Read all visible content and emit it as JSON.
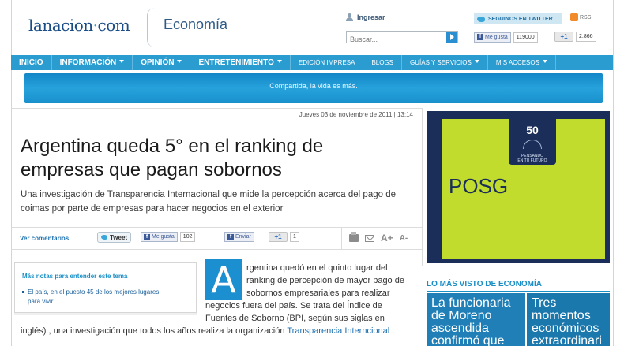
{
  "header": {
    "logo_main": "lanacion",
    "logo_dot": "·",
    "logo_tld": "com",
    "section": "Economía",
    "login_label": "Ingresar",
    "search_placeholder": "Buscar...",
    "twitter_follow": "SEGUINOS EN TWITTER",
    "rss": "RSS",
    "fb_like": "Me gusta",
    "fb_count": "119000",
    "gplus_label": "+1",
    "gplus_count": "2.866"
  },
  "nav": {
    "items": [
      "INICIO",
      "INFORMACIÓN",
      "OPINIÓN",
      "ENTRETENIMIENTO",
      "EDICIÓN IMPRESA",
      "BLOGS",
      "GUÍAS Y SERVICIOS",
      "MIS ACCESOS"
    ]
  },
  "banner": {
    "text": "Compartida, la vida es más."
  },
  "article": {
    "date": "Jueves 03 de noviembre de 2011 | 13:14",
    "headline_1": "Argentina queda 5° en el ranking de",
    "headline_2": "empresas que pagan sobornos",
    "subtitle_1": "Una investigación de Transparencia Internacional que mide la percepción acerca del pago de",
    "subtitle_2": "coimas por parte de empresas para hacer negocios en el exterior",
    "dropcap": "A",
    "body": [
      "rgentina quedó en el quinto lugar del",
      "ranking de percepción de mayor pago de",
      "sobornos empresariales para realizar",
      "negocios fuera del país. Se trata del Índice de",
      "Fuentes de Soborno (BPI, según sus siglas en",
      "inglés) , una investigación que todos los años realiza la organización"
    ],
    "body_link": "Transparencia Interncional",
    "body_end": " ."
  },
  "share": {
    "comments": "Ver comentarios",
    "tweet": "Tweet",
    "fb_like": "Me gusta",
    "fb_count": "102",
    "send": "Enviar",
    "gplus": "+1",
    "gplus_count": "1",
    "font_up": "A+",
    "font_down": "A-"
  },
  "related": {
    "title": "Más notas para entender este tema",
    "item_1": "El país, en el puesto 45 de los mejores lugares",
    "item_2": "para vivir"
  },
  "ad": {
    "badge": "50",
    "tagline_1": "PENSANDO",
    "tagline_2": "EN TU FUTURO",
    "text": "POSG"
  },
  "most_seen": {
    "title": "LO MÁS VISTO DE ECONOMÍA",
    "items": [
      [
        "La funcionaria",
        "de Moreno",
        "ascendida",
        "confirmó que"
      ],
      [
        "Tres",
        "momentos",
        "económicos",
        "extraordinari"
      ]
    ]
  },
  "colors": {
    "accent": "#2a9cd0",
    "brand": "#1a4d86",
    "ad_green": "#c2dc2e"
  }
}
